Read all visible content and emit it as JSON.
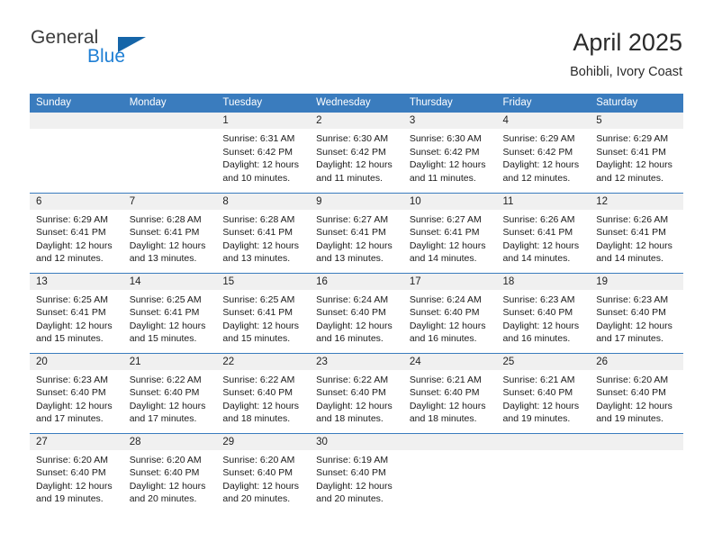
{
  "brand": {
    "word_one": "General",
    "word_two": "Blue",
    "triangle_icon": "brand-triangle-icon",
    "accent_dark": "#1565a8",
    "accent_light": "#1f7fd4"
  },
  "header": {
    "title": "April 2025",
    "location": "Bohibli, Ivory Coast"
  },
  "theme": {
    "header_blue": "#3a7cbe",
    "daystrip_gray": "#f0f0f0",
    "text": "#1a1a1a"
  },
  "calendar": {
    "weekday_headers": [
      "Sunday",
      "Monday",
      "Tuesday",
      "Wednesday",
      "Thursday",
      "Friday",
      "Saturday"
    ],
    "weeks": [
      [
        {
          "day": "",
          "sunrise": "",
          "sunset": "",
          "daylight": ""
        },
        {
          "day": "",
          "sunrise": "",
          "sunset": "",
          "daylight": ""
        },
        {
          "day": "1",
          "sunrise": "Sunrise: 6:31 AM",
          "sunset": "Sunset: 6:42 PM",
          "daylight": "Daylight: 12 hours and 10 minutes."
        },
        {
          "day": "2",
          "sunrise": "Sunrise: 6:30 AM",
          "sunset": "Sunset: 6:42 PM",
          "daylight": "Daylight: 12 hours and 11 minutes."
        },
        {
          "day": "3",
          "sunrise": "Sunrise: 6:30 AM",
          "sunset": "Sunset: 6:42 PM",
          "daylight": "Daylight: 12 hours and 11 minutes."
        },
        {
          "day": "4",
          "sunrise": "Sunrise: 6:29 AM",
          "sunset": "Sunset: 6:42 PM",
          "daylight": "Daylight: 12 hours and 12 minutes."
        },
        {
          "day": "5",
          "sunrise": "Sunrise: 6:29 AM",
          "sunset": "Sunset: 6:41 PM",
          "daylight": "Daylight: 12 hours and 12 minutes."
        }
      ],
      [
        {
          "day": "6",
          "sunrise": "Sunrise: 6:29 AM",
          "sunset": "Sunset: 6:41 PM",
          "daylight": "Daylight: 12 hours and 12 minutes."
        },
        {
          "day": "7",
          "sunrise": "Sunrise: 6:28 AM",
          "sunset": "Sunset: 6:41 PM",
          "daylight": "Daylight: 12 hours and 13 minutes."
        },
        {
          "day": "8",
          "sunrise": "Sunrise: 6:28 AM",
          "sunset": "Sunset: 6:41 PM",
          "daylight": "Daylight: 12 hours and 13 minutes."
        },
        {
          "day": "9",
          "sunrise": "Sunrise: 6:27 AM",
          "sunset": "Sunset: 6:41 PM",
          "daylight": "Daylight: 12 hours and 13 minutes."
        },
        {
          "day": "10",
          "sunrise": "Sunrise: 6:27 AM",
          "sunset": "Sunset: 6:41 PM",
          "daylight": "Daylight: 12 hours and 14 minutes."
        },
        {
          "day": "11",
          "sunrise": "Sunrise: 6:26 AM",
          "sunset": "Sunset: 6:41 PM",
          "daylight": "Daylight: 12 hours and 14 minutes."
        },
        {
          "day": "12",
          "sunrise": "Sunrise: 6:26 AM",
          "sunset": "Sunset: 6:41 PM",
          "daylight": "Daylight: 12 hours and 14 minutes."
        }
      ],
      [
        {
          "day": "13",
          "sunrise": "Sunrise: 6:25 AM",
          "sunset": "Sunset: 6:41 PM",
          "daylight": "Daylight: 12 hours and 15 minutes."
        },
        {
          "day": "14",
          "sunrise": "Sunrise: 6:25 AM",
          "sunset": "Sunset: 6:41 PM",
          "daylight": "Daylight: 12 hours and 15 minutes."
        },
        {
          "day": "15",
          "sunrise": "Sunrise: 6:25 AM",
          "sunset": "Sunset: 6:41 PM",
          "daylight": "Daylight: 12 hours and 15 minutes."
        },
        {
          "day": "16",
          "sunrise": "Sunrise: 6:24 AM",
          "sunset": "Sunset: 6:40 PM",
          "daylight": "Daylight: 12 hours and 16 minutes."
        },
        {
          "day": "17",
          "sunrise": "Sunrise: 6:24 AM",
          "sunset": "Sunset: 6:40 PM",
          "daylight": "Daylight: 12 hours and 16 minutes."
        },
        {
          "day": "18",
          "sunrise": "Sunrise: 6:23 AM",
          "sunset": "Sunset: 6:40 PM",
          "daylight": "Daylight: 12 hours and 16 minutes."
        },
        {
          "day": "19",
          "sunrise": "Sunrise: 6:23 AM",
          "sunset": "Sunset: 6:40 PM",
          "daylight": "Daylight: 12 hours and 17 minutes."
        }
      ],
      [
        {
          "day": "20",
          "sunrise": "Sunrise: 6:23 AM",
          "sunset": "Sunset: 6:40 PM",
          "daylight": "Daylight: 12 hours and 17 minutes."
        },
        {
          "day": "21",
          "sunrise": "Sunrise: 6:22 AM",
          "sunset": "Sunset: 6:40 PM",
          "daylight": "Daylight: 12 hours and 17 minutes."
        },
        {
          "day": "22",
          "sunrise": "Sunrise: 6:22 AM",
          "sunset": "Sunset: 6:40 PM",
          "daylight": "Daylight: 12 hours and 18 minutes."
        },
        {
          "day": "23",
          "sunrise": "Sunrise: 6:22 AM",
          "sunset": "Sunset: 6:40 PM",
          "daylight": "Daylight: 12 hours and 18 minutes."
        },
        {
          "day": "24",
          "sunrise": "Sunrise: 6:21 AM",
          "sunset": "Sunset: 6:40 PM",
          "daylight": "Daylight: 12 hours and 18 minutes."
        },
        {
          "day": "25",
          "sunrise": "Sunrise: 6:21 AM",
          "sunset": "Sunset: 6:40 PM",
          "daylight": "Daylight: 12 hours and 19 minutes."
        },
        {
          "day": "26",
          "sunrise": "Sunrise: 6:20 AM",
          "sunset": "Sunset: 6:40 PM",
          "daylight": "Daylight: 12 hours and 19 minutes."
        }
      ],
      [
        {
          "day": "27",
          "sunrise": "Sunrise: 6:20 AM",
          "sunset": "Sunset: 6:40 PM",
          "daylight": "Daylight: 12 hours and 19 minutes."
        },
        {
          "day": "28",
          "sunrise": "Sunrise: 6:20 AM",
          "sunset": "Sunset: 6:40 PM",
          "daylight": "Daylight: 12 hours and 20 minutes."
        },
        {
          "day": "29",
          "sunrise": "Sunrise: 6:20 AM",
          "sunset": "Sunset: 6:40 PM",
          "daylight": "Daylight: 12 hours and 20 minutes."
        },
        {
          "day": "30",
          "sunrise": "Sunrise: 6:19 AM",
          "sunset": "Sunset: 6:40 PM",
          "daylight": "Daylight: 12 hours and 20 minutes."
        },
        {
          "day": "",
          "sunrise": "",
          "sunset": "",
          "daylight": ""
        },
        {
          "day": "",
          "sunrise": "",
          "sunset": "",
          "daylight": ""
        },
        {
          "day": "",
          "sunrise": "",
          "sunset": "",
          "daylight": ""
        }
      ]
    ]
  }
}
